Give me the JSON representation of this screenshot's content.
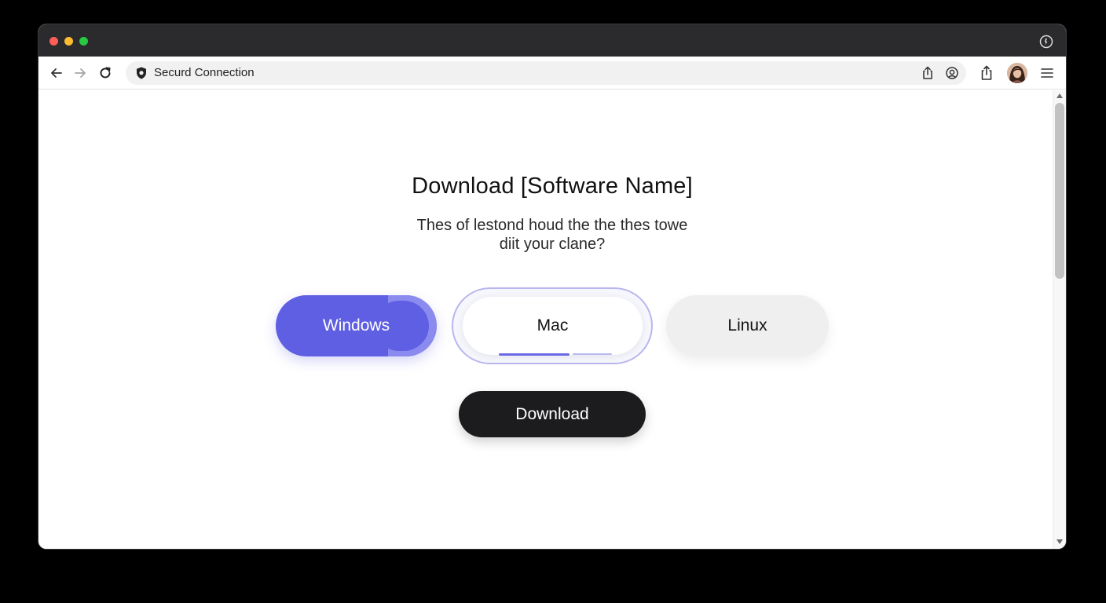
{
  "browser": {
    "address_text": "Securd Connection",
    "icons": {
      "back": "back-arrow-icon",
      "forward": "forward-arrow-icon",
      "reload": "reload-icon",
      "security": "shield-icon",
      "share": "share-icon",
      "lens": "lens-icon",
      "menu": "hamburger-menu-icon",
      "extension": "extension-icon"
    }
  },
  "page": {
    "title": "Download [Software Name]",
    "subtitle_line1": "Thes of lestond houd the the thes towe",
    "subtitle_line2": "diit your clane?",
    "os_options": [
      {
        "label": "Windows",
        "state": "highlighted"
      },
      {
        "label": "Mac",
        "state": "selected"
      },
      {
        "label": "Linux",
        "state": "default"
      }
    ],
    "download_label": "Download"
  },
  "colors": {
    "accent": "#5f5fe3",
    "download_button": "#1c1c1e",
    "titlebar": "#2b2b2d"
  }
}
